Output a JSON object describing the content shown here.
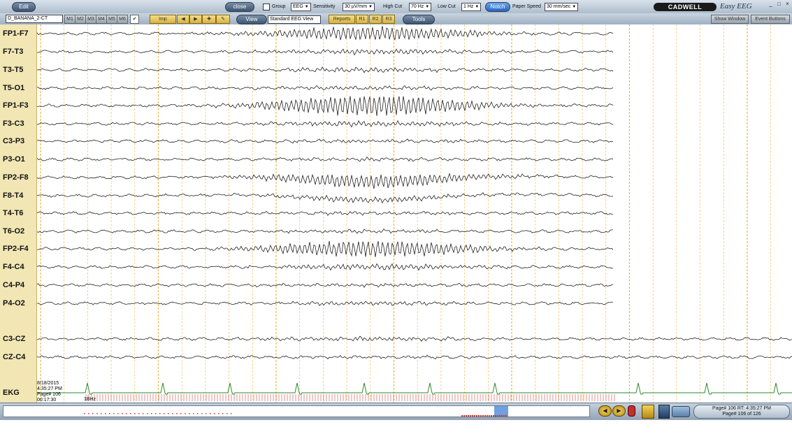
{
  "toolbar": {
    "edit_label": "Edit",
    "montage": "D_BANANA_2-CT",
    "montage_buttons": [
      "M1",
      "M2",
      "M3",
      "M4",
      "M5",
      "M6"
    ],
    "close_label": "close",
    "group_label": "Group",
    "group_value": "EEG",
    "sensitivity_label": "Sensitivity",
    "sensitivity_value": "30 µV/mm",
    "highcut_label": "High Cut",
    "highcut_value": "70 Hz",
    "lowcut_label": "Low Cut",
    "lowcut_value": "1 Hz",
    "notch_label": "Notch",
    "paperspeed_label": "Paper Speed",
    "paperspeed_value": "30 mm/sec",
    "imp_label": "Imp",
    "view_label": "View",
    "view_value": "Standard EEG View",
    "reports_label": "Reports",
    "r_buttons": [
      "R1",
      "R2",
      "R3"
    ],
    "tools_label": "Tools",
    "show_window_label": "Show Window",
    "event_buttons_label": "Event Buttons",
    "logo": "CADWELL",
    "app_name": "Easy EEG"
  },
  "channels": [
    "FP1-F7",
    "F7-T3",
    "T3-T5",
    "T5-O1",
    "FP1-F3",
    "F3-C3",
    "C3-P3",
    "P3-O1",
    "FP2-F8",
    "F8-T4",
    "T4-T6",
    "T6-O2",
    "FP2-F4",
    "F4-C4",
    "C4-P4",
    "P4-O2",
    "C3-CZ",
    "CZ-C4",
    "EKG"
  ],
  "info": {
    "date": "8/18/2015",
    "time": "4:35:27 PM",
    "page": "Page# 106",
    "elapsed": "00:17:30",
    "marker": "1BHz"
  },
  "status": {
    "line1": "Page# 106  RT: 4:35:27 PM",
    "line2": "Page# 106 of 126"
  },
  "colors": {
    "trace": "#222222",
    "ekg": "#2a8a2a",
    "grid": "#e8b84a",
    "label_panel": "#f1e6b4",
    "notch_button": "#3f7fd6"
  },
  "icons": [
    "checkbox-icon",
    "left-arrow-icon",
    "right-arrow-icon",
    "marker-icon",
    "play-back-icon",
    "play-forward-icon",
    "window-minimize-icon",
    "window-maximize-icon",
    "window-close-icon"
  ]
}
